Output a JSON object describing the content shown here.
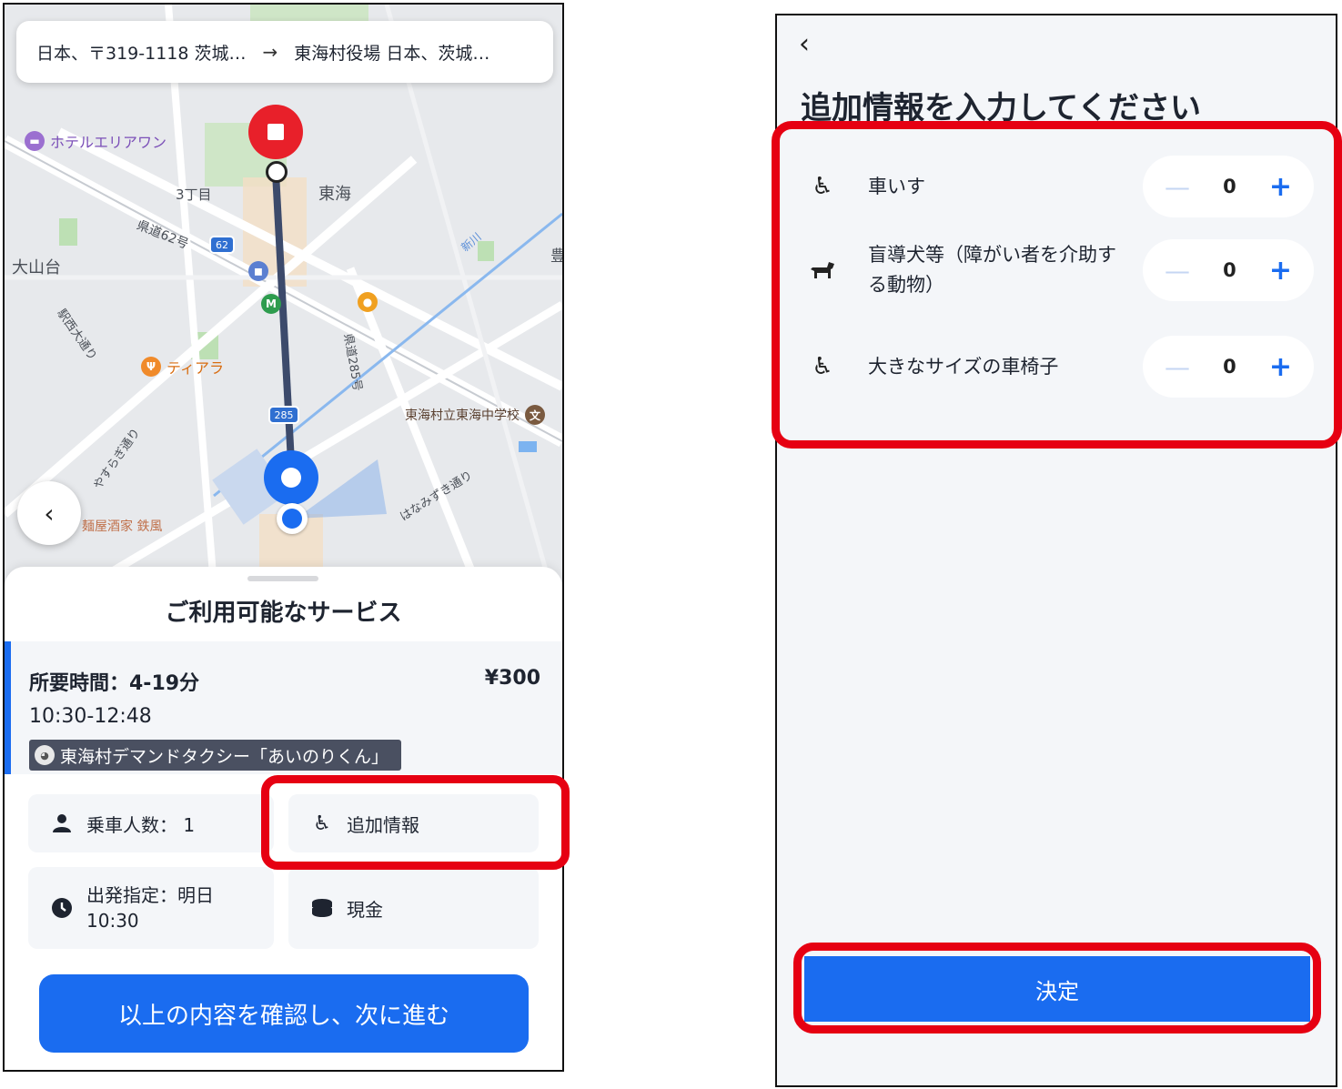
{
  "left": {
    "address": {
      "origin": "日本、〒319-1118 茨城…",
      "destination": "東海村役場 日本、茨城…"
    },
    "map_labels": {
      "hotel": "ホテルエリアワン",
      "chome": "3丁目",
      "tokai": "東海",
      "route62": "県道62号",
      "shield62": "62",
      "oyamadai": "大山台",
      "ekinishi": "駅西大通り",
      "tiara": "ティアラ",
      "route285": "県道285号",
      "shield285": "285",
      "school": "東海村立東海中学校",
      "school_mark": "文",
      "hanamizuki": "はなみずき通り",
      "yasuragi": "やすらぎ通り",
      "menya": "麺屋酒家 鉄風",
      "yutaka": "豊",
      "river": "新川"
    },
    "sheet_title": "ご利用可能なサービス",
    "service": {
      "duration": "所要時間：4-19分",
      "price": "¥300",
      "time_range": "10:30-12:48",
      "name": "東海村デマンドタクシー「あいのりくん」"
    },
    "options": {
      "passengers": "乗車人数： 1",
      "extra_info": "追加情報",
      "departure_line1": "出発指定：明日",
      "departure_line2": "10:30",
      "payment": "現金"
    },
    "confirm_button": "以上の内容を確認し、次に進む"
  },
  "right": {
    "title": "追加情報を入力してください",
    "rows": [
      {
        "label": "車いす",
        "value": "0",
        "icon": "wheelchair-icon"
      },
      {
        "label": "盲導犬等（障がい者を介助する動物）",
        "value": "0",
        "icon": "dog-icon"
      },
      {
        "label": "大きなサイズの車椅子",
        "value": "0",
        "icon": "wheelchair-icon"
      }
    ],
    "decide_button": "決定"
  },
  "colors": {
    "accent": "#1a6cf0",
    "highlight": "#e60012",
    "destination_pin": "#e8202a",
    "tile_bg": "#f4f6f9"
  }
}
